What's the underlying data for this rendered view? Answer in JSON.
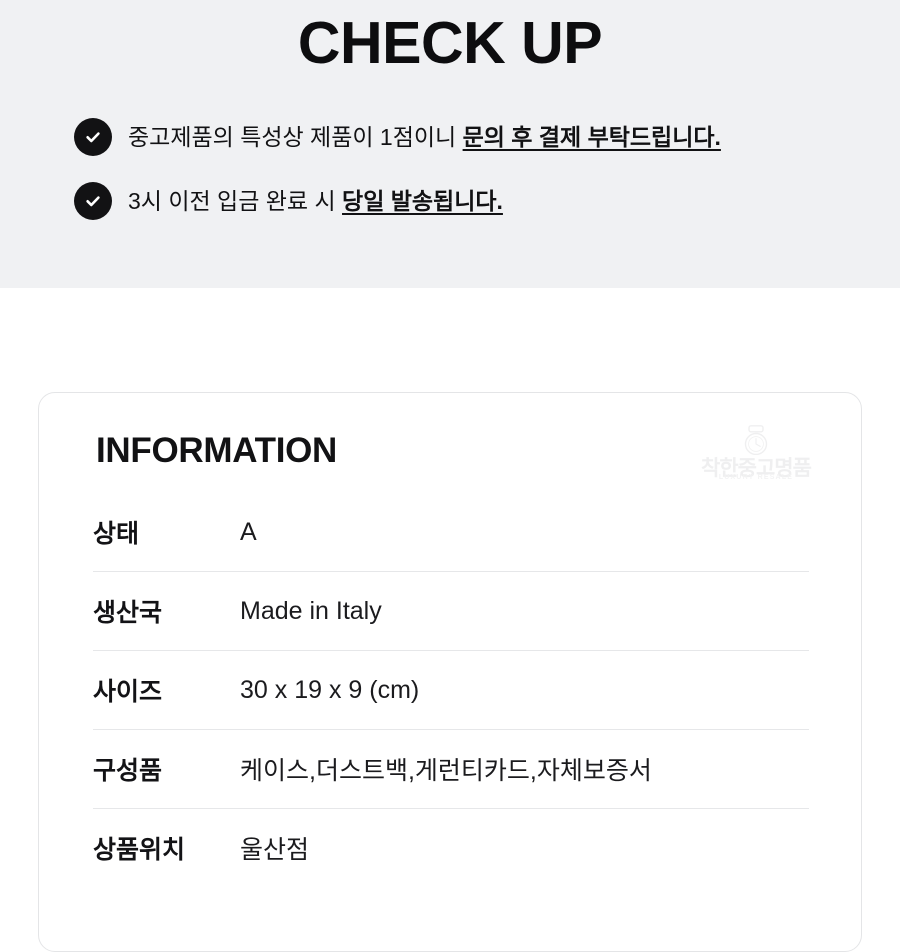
{
  "checkup": {
    "title": "CHECK UP",
    "items": [
      {
        "icon": "check-circle-icon",
        "text_plain": "중고제품의 특성상 제품이 1점이니 ",
        "text_strong": "문의 후 결제 부탁드립니다."
      },
      {
        "icon": "check-circle-icon",
        "text_plain": "3시 이전 입금 완료 시 ",
        "text_strong": "당일 발송됩니다."
      }
    ]
  },
  "information": {
    "heading": "INFORMATION",
    "watermark": {
      "icon": "watch-icon",
      "name": "착한중고명품",
      "subtitle": "LUXURY RESALE"
    },
    "rows": [
      {
        "label": "상태",
        "value": "A"
      },
      {
        "label": "생산국",
        "value": "Made in Italy"
      },
      {
        "label": "사이즈",
        "value": "30 x 19 x 9 (cm)"
      },
      {
        "label": "구성품",
        "value": "케이스,더스트백,게런티카드,자체보증서"
      },
      {
        "label": "상품위치",
        "value": "울산점"
      }
    ]
  },
  "colors": {
    "banner_background": "#f0f1f3",
    "page_background": "#ffffff",
    "text_primary": "#121214",
    "badge_fill": "#121214",
    "badge_check": "#ffffff",
    "card_border": "#e4e5e7",
    "row_divider": "#e6e7e9"
  }
}
